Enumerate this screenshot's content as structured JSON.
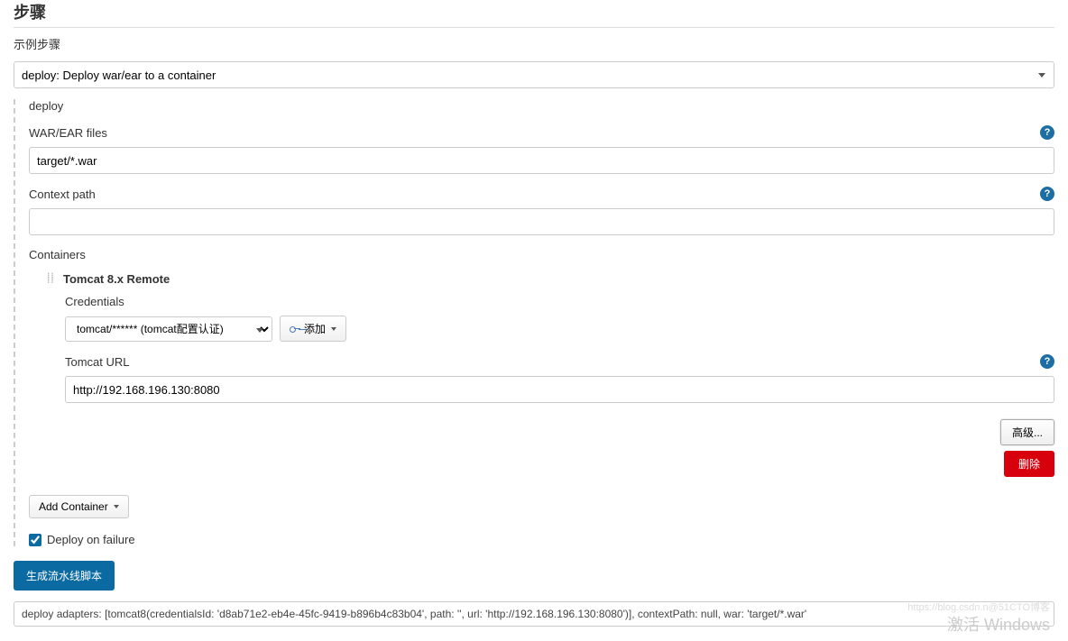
{
  "header": {
    "title": "步骤",
    "sample_label": "示例步骤"
  },
  "step_select": {
    "value": "deploy: Deploy war/ear to a container"
  },
  "deploy": {
    "title": "deploy",
    "war_label": "WAR/EAR files",
    "war_value": "target/*.war",
    "context_label": "Context path",
    "context_value": "",
    "containers_label": "Containers",
    "container": {
      "title": "Tomcat 8.x Remote",
      "cred_label": "Credentials",
      "cred_value": "tomcat/****** (tomcat配置认证)",
      "add_btn": "添加",
      "url_label": "Tomcat URL",
      "url_value": "http://192.168.196.130:8080"
    },
    "advanced_btn": "高级...",
    "delete_btn": "删除",
    "add_container_btn": "Add Container",
    "deploy_on_failure_label": "Deploy on failure"
  },
  "generate_btn": "生成流水线脚本",
  "output": "deploy adapters: [tomcat8(credentialsId: 'd8ab71e2-eb4e-45fc-9419-b896b4c83b04', path: '', url: 'http://192.168.196.130:8080')], contextPath: null, war: 'target/*.war'",
  "watermark": "激活 Windows",
  "watermark_small": "https://blog.csdn.n@51CTO博客"
}
